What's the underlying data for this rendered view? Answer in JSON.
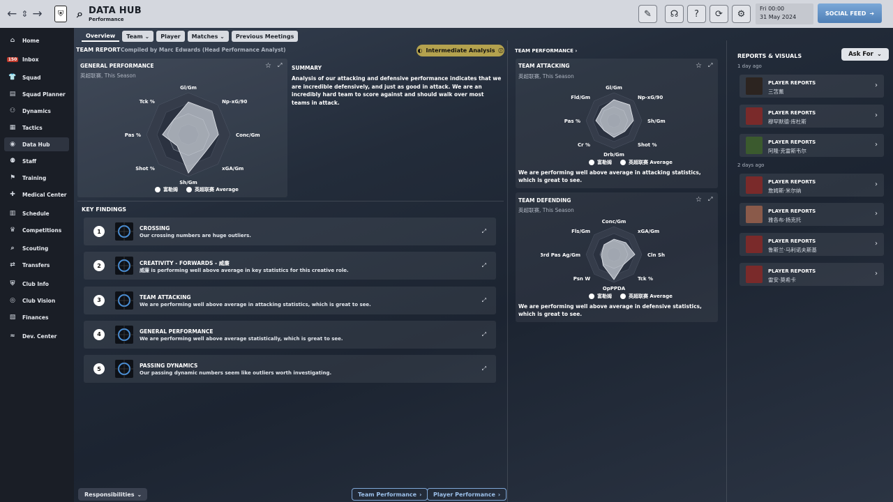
{
  "topbar": {
    "back_icon": "arrow-left-icon",
    "updown_icon": "chevron-updown-icon",
    "forward_icon": "arrow-right-icon",
    "title": "DATA HUB",
    "subtitle": "Performance",
    "date_line1": "Fri 00:00",
    "date_line2": "31 May 2024",
    "social_feed": "SOCIAL FEED"
  },
  "sidebar": {
    "items": [
      {
        "label": "Home",
        "icon": "home-icon"
      },
      {
        "label": "Inbox",
        "icon": "inbox-icon",
        "badge": "150"
      },
      {
        "label": "Squad",
        "icon": "shirt-icon"
      },
      {
        "label": "Squad Planner",
        "icon": "clipboard-icon"
      },
      {
        "label": "Dynamics",
        "icon": "people-icon"
      },
      {
        "label": "Tactics",
        "icon": "board-icon"
      },
      {
        "label": "Data Hub",
        "icon": "data-icon"
      },
      {
        "label": "Staff",
        "icon": "staff-icon"
      },
      {
        "label": "Training",
        "icon": "training-icon"
      },
      {
        "label": "Medical Center",
        "icon": "medical-icon"
      },
      {
        "label": "Schedule",
        "icon": "calendar-icon"
      },
      {
        "label": "Competitions",
        "icon": "trophy-icon"
      },
      {
        "label": "Scouting",
        "icon": "scouting-icon"
      },
      {
        "label": "Transfers",
        "icon": "transfer-icon"
      },
      {
        "label": "Club Info",
        "icon": "shield-icon"
      },
      {
        "label": "Club Vision",
        "icon": "vision-icon"
      },
      {
        "label": "Finances",
        "icon": "finance-icon"
      },
      {
        "label": "Dev. Center",
        "icon": "dev-icon"
      }
    ]
  },
  "tabs": [
    {
      "label": "Overview"
    },
    {
      "label": "Team ⌄"
    },
    {
      "label": "Player"
    },
    {
      "label": "Matches ⌄"
    },
    {
      "label": "Previous Meetings"
    }
  ],
  "team_report": {
    "heading": "TEAM REPORT",
    "compiled_by": "Compiled by Marc Edwards (Head Performance Analyst)",
    "badge": "Intermediate Analysis",
    "general": {
      "title": "GENERAL PERFORMANCE",
      "scope": "英超联赛, This Season",
      "axes": [
        "Gl/Gm",
        "Np-xG/90",
        "Conc/Gm",
        "xGA/Gm",
        "Sh/Gm",
        "Shot %",
        "Pas %",
        "Tck %"
      ],
      "team_values": [
        0.78,
        0.8,
        0.72,
        0.58,
        0.92,
        0.38,
        0.62,
        0.5
      ],
      "legend_team": "富勒姆",
      "legend_avg": "英超联赛 Average"
    },
    "summary_title": "SUMMARY",
    "summary_text": "Analysis of our attacking and defensive performance indicates that we are incredible defensively, and just as good in attack. We are an incredibly hard team to score against and should walk over most teams in attack."
  },
  "key_findings": {
    "heading": "KEY FINDINGS",
    "items": [
      {
        "num": "1",
        "title": "CROSSING",
        "desc": "Our crossing numbers are huge outliers."
      },
      {
        "num": "2",
        "title": "CREATIVITY - FORWARDS - 威廉",
        "desc": "威廉 is performing well above average in key statistics for this creative role."
      },
      {
        "num": "3",
        "title": "TEAM ATTACKING",
        "desc": "We are performing well above average in attacking statistics, which is great to see."
      },
      {
        "num": "4",
        "title": "GENERAL PERFORMANCE",
        "desc": "We are performing well above average statistically, which is great to see."
      },
      {
        "num": "5",
        "title": "PASSING DYNAMICS",
        "desc": "Our passing dynamic numbers seem like outliers worth investigating."
      }
    ]
  },
  "team_performance": {
    "heading": "TEAM PERFORMANCE ›",
    "attacking": {
      "title": "TEAM ATTACKING",
      "scope": "英超联赛, This Season",
      "axes": [
        "Gl/Gm",
        "Np-xG/90",
        "Sh/Gm",
        "Shot %",
        "Drb/Gm",
        "Cr %",
        "Pas %",
        "Fld/Gm"
      ],
      "team_values": [
        0.75,
        0.8,
        0.7,
        0.55,
        0.6,
        0.5,
        0.65,
        0.6
      ],
      "legend_team": "富勒姆",
      "legend_avg": "英超联赛 Average",
      "note": "We are performing well above average in attacking statistics, which is great to see."
    },
    "defending": {
      "title": "TEAM DEFENDING",
      "scope": "英超联赛, This Season",
      "axes": [
        "Conc/Gm",
        "xGA/Gm",
        "Cln Sh",
        "Tck %",
        "OpPPDA",
        "Psn W",
        "F 3rd Pas Ag/Gm",
        "Fls/Gm"
      ],
      "team_values": [
        0.55,
        0.6,
        0.75,
        0.5,
        0.9,
        0.55,
        0.45,
        0.5
      ],
      "legend_team": "富勒姆",
      "legend_avg": "英超联赛 Average",
      "note": "We are performing well above average in defensive statistics, which is great to see."
    }
  },
  "reports": {
    "heading": "REPORTS & VISUALS",
    "ask_for": "Ask For",
    "group1": "1 day ago",
    "group2": "2 days ago",
    "items": [
      {
        "type": "PLAYER REPORTS",
        "name": "三笘薰"
      },
      {
        "type": "PLAYER REPORTS",
        "name": "穆罕默德·库杜斯"
      },
      {
        "type": "PLAYER REPORTS",
        "name": "阿隆·克雷斯韦尔"
      },
      {
        "type": "PLAYER REPORTS",
        "name": "詹姆斯·米尔纳"
      },
      {
        "type": "PLAYER REPORTS",
        "name": "雅各布·扬克托"
      },
      {
        "type": "PLAYER REPORTS",
        "name": "鲁斯兰·马利诺夫斯基"
      },
      {
        "type": "PLAYER REPORTS",
        "name": "雷安·莫希卡"
      }
    ]
  },
  "bottom": {
    "responsibilities": "Responsibilities",
    "team_perf_btn": "Team Performance",
    "player_perf_btn": "Player Performance"
  },
  "colors": {
    "accent_badge": "#b4a24e",
    "social": "#5a8cc4",
    "sidebar_bg": "#1a1e26"
  }
}
